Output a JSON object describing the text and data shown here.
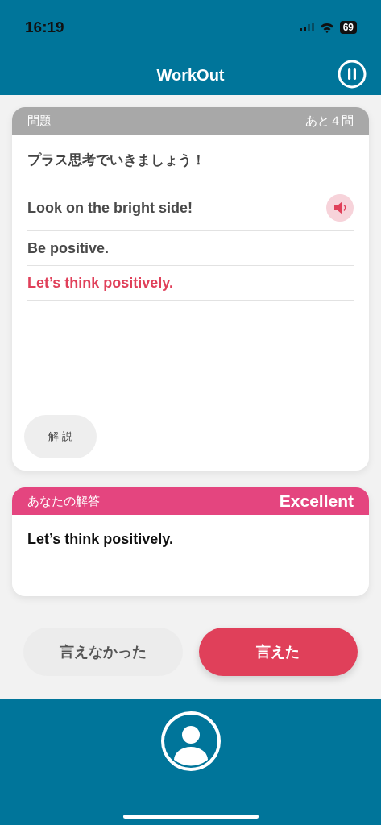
{
  "status_bar": {
    "time": "16:19",
    "battery": "69"
  },
  "header": {
    "title": "WorkOut"
  },
  "question": {
    "label": "問題",
    "remaining": "あと４問",
    "prompt": "プラス思考でいきましょう！",
    "answers": [
      {
        "text": "Look on the bright side!",
        "highlighted": false,
        "audio": true
      },
      {
        "text": "Be positive.",
        "highlighted": false,
        "audio": false
      },
      {
        "text": "Let’s think positively.",
        "highlighted": true,
        "audio": false
      }
    ],
    "explain_button": "解 説"
  },
  "response": {
    "label": "あなたの解答",
    "grade": "Excellent",
    "text": "Let’s think positively."
  },
  "buttons": [
    {
      "label": "言えなかった",
      "kind": "secondary"
    },
    {
      "label": "言えた",
      "kind": "primary"
    }
  ]
}
